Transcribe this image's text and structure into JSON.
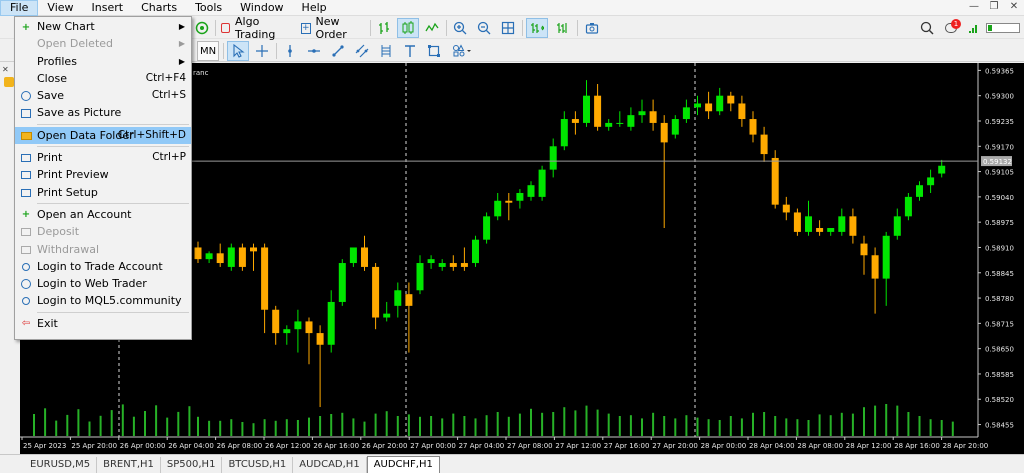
{
  "menu": {
    "items": [
      "File",
      "View",
      "Insert",
      "Charts",
      "Tools",
      "Window",
      "Help"
    ],
    "active_index": 0
  },
  "toolbar1": {
    "algo_trading": "Algo Trading",
    "new_order": "New Order",
    "notification_count": "1"
  },
  "toolbar2": {
    "timeframe": "MN"
  },
  "chart": {
    "symbol_fragment": "ranc",
    "current_price": "0.59132",
    "bull_color": "#00e600",
    "bear_color": "#ffaa00",
    "background": "#000000"
  },
  "chart_data": {
    "type": "candlestick",
    "symbol_tab": "AUDCHF,H1",
    "y_ticks": [
      "0.59365",
      "0.59300",
      "0.59235",
      "0.59170",
      "0.59105",
      "0.59040",
      "0.58975",
      "0.58910",
      "0.58845",
      "0.58780",
      "0.58715",
      "0.58650",
      "0.58585",
      "0.58520",
      "0.58455"
    ],
    "ylim": [
      0.58423,
      0.59384
    ],
    "x_ticks": [
      "25 Apr 2023",
      "25 Apr 20:00",
      "26 Apr 00:00",
      "26 Apr 04:00",
      "26 Apr 08:00",
      "26 Apr 12:00",
      "26 Apr 16:00",
      "26 Apr 20:00",
      "27 Apr 00:00",
      "27 Apr 04:00",
      "27 Apr 08:00",
      "27 Apr 12:00",
      "27 Apr 16:00",
      "27 Apr 20:00",
      "28 Apr 00:00",
      "28 Apr 04:00",
      "28 Apr 08:00",
      "28 Apr 12:00",
      "28 Apr 16:00",
      "28 Apr 20:00"
    ],
    "candles": [
      {
        "o": 0.5891,
        "h": 0.58925,
        "c": 0.5888,
        "l": 0.5887
      },
      {
        "o": 0.5888,
        "h": 0.589,
        "c": 0.58895,
        "l": 0.5887
      },
      {
        "o": 0.58895,
        "h": 0.5892,
        "c": 0.5887,
        "l": 0.5886
      },
      {
        "o": 0.5886,
        "h": 0.5892,
        "c": 0.5891,
        "l": 0.5885
      },
      {
        "o": 0.5891,
        "h": 0.5892,
        "c": 0.5886,
        "l": 0.5885
      },
      {
        "o": 0.5891,
        "h": 0.5892,
        "c": 0.589,
        "l": 0.5885
      },
      {
        "o": 0.5891,
        "h": 0.5892,
        "c": 0.5875,
        "l": 0.5869
      },
      {
        "o": 0.5875,
        "h": 0.5876,
        "c": 0.5869,
        "l": 0.5866
      },
      {
        "o": 0.5869,
        "h": 0.5871,
        "c": 0.587,
        "l": 0.5866
      },
      {
        "o": 0.587,
        "h": 0.5875,
        "c": 0.5872,
        "l": 0.5864
      },
      {
        "o": 0.5872,
        "h": 0.5873,
        "c": 0.5869,
        "l": 0.5861
      },
      {
        "o": 0.5869,
        "h": 0.5871,
        "c": 0.5866,
        "l": 0.585
      },
      {
        "o": 0.5866,
        "h": 0.588,
        "c": 0.5877,
        "l": 0.5864
      },
      {
        "o": 0.5877,
        "h": 0.5888,
        "c": 0.5887,
        "l": 0.5876
      },
      {
        "o": 0.5887,
        "h": 0.5889,
        "c": 0.5891,
        "l": 0.5886
      },
      {
        "o": 0.5891,
        "h": 0.5894,
        "c": 0.5886,
        "l": 0.5885
      },
      {
        "o": 0.5886,
        "h": 0.5887,
        "c": 0.5873,
        "l": 0.587
      },
      {
        "o": 0.5873,
        "h": 0.5877,
        "c": 0.5874,
        "l": 0.5872
      },
      {
        "o": 0.5876,
        "h": 0.5882,
        "c": 0.588,
        "l": 0.5873
      },
      {
        "o": 0.5879,
        "h": 0.5882,
        "c": 0.5876,
        "l": 0.5864
      },
      {
        "o": 0.588,
        "h": 0.5889,
        "c": 0.5887,
        "l": 0.5879
      },
      {
        "o": 0.5887,
        "h": 0.5889,
        "c": 0.5888,
        "l": 0.58855
      },
      {
        "o": 0.5886,
        "h": 0.5888,
        "c": 0.5887,
        "l": 0.5885
      },
      {
        "o": 0.5887,
        "h": 0.5889,
        "c": 0.5886,
        "l": 0.5885
      },
      {
        "o": 0.5887,
        "h": 0.5891,
        "c": 0.5886,
        "l": 0.5885
      },
      {
        "o": 0.5887,
        "h": 0.5894,
        "c": 0.5893,
        "l": 0.5886
      },
      {
        "o": 0.5893,
        "h": 0.59,
        "c": 0.5899,
        "l": 0.5892
      },
      {
        "o": 0.5899,
        "h": 0.5905,
        "c": 0.5903,
        "l": 0.5898
      },
      {
        "o": 0.5903,
        "h": 0.5905,
        "c": 0.59025,
        "l": 0.5898
      },
      {
        "o": 0.5903,
        "h": 0.5906,
        "c": 0.5905,
        "l": 0.5901
      },
      {
        "o": 0.5904,
        "h": 0.5908,
        "c": 0.5907,
        "l": 0.5903
      },
      {
        "o": 0.5904,
        "h": 0.5912,
        "c": 0.5911,
        "l": 0.5903
      },
      {
        "o": 0.5911,
        "h": 0.5919,
        "c": 0.5917,
        "l": 0.5909
      },
      {
        "o": 0.5917,
        "h": 0.5926,
        "c": 0.5924,
        "l": 0.5916
      },
      {
        "o": 0.5924,
        "h": 0.5926,
        "c": 0.5923,
        "l": 0.592
      },
      {
        "o": 0.5923,
        "h": 0.5934,
        "c": 0.593,
        "l": 0.5922
      },
      {
        "o": 0.593,
        "h": 0.5933,
        "c": 0.5922,
        "l": 0.5921
      },
      {
        "o": 0.5922,
        "h": 0.5924,
        "c": 0.5923,
        "l": 0.5921
      },
      {
        "o": 0.5923,
        "h": 0.5926,
        "c": 0.5923,
        "l": 0.5922
      },
      {
        "o": 0.5922,
        "h": 0.5927,
        "c": 0.5925,
        "l": 0.5921
      },
      {
        "o": 0.5925,
        "h": 0.5929,
        "c": 0.5926,
        "l": 0.5923
      },
      {
        "o": 0.5926,
        "h": 0.5929,
        "c": 0.5923,
        "l": 0.5921
      },
      {
        "o": 0.5923,
        "h": 0.5925,
        "c": 0.5918,
        "l": 0.5896
      },
      {
        "o": 0.592,
        "h": 0.5925,
        "c": 0.5924,
        "l": 0.5919
      },
      {
        "o": 0.5924,
        "h": 0.5929,
        "c": 0.5927,
        "l": 0.5923
      },
      {
        "o": 0.5927,
        "h": 0.593,
        "c": 0.5928,
        "l": 0.5925
      },
      {
        "o": 0.5928,
        "h": 0.5931,
        "c": 0.5926,
        "l": 0.5924
      },
      {
        "o": 0.5926,
        "h": 0.5932,
        "c": 0.593,
        "l": 0.5925
      },
      {
        "o": 0.593,
        "h": 0.5931,
        "c": 0.5928,
        "l": 0.5926
      },
      {
        "o": 0.5928,
        "h": 0.593,
        "c": 0.5924,
        "l": 0.5922
      },
      {
        "o": 0.5924,
        "h": 0.5926,
        "c": 0.592,
        "l": 0.5918
      },
      {
        "o": 0.592,
        "h": 0.5922,
        "c": 0.5915,
        "l": 0.5913
      },
      {
        "o": 0.5914,
        "h": 0.5916,
        "c": 0.5902,
        "l": 0.5901
      },
      {
        "o": 0.5902,
        "h": 0.5904,
        "c": 0.59,
        "l": 0.5898
      },
      {
        "o": 0.59,
        "h": 0.5901,
        "c": 0.5895,
        "l": 0.5894
      },
      {
        "o": 0.5895,
        "h": 0.5903,
        "c": 0.5899,
        "l": 0.5894
      },
      {
        "o": 0.5896,
        "h": 0.5898,
        "c": 0.5895,
        "l": 0.5894
      },
      {
        "o": 0.5895,
        "h": 0.5896,
        "c": 0.5896,
        "l": 0.5894
      },
      {
        "o": 0.5895,
        "h": 0.5901,
        "c": 0.5899,
        "l": 0.5894
      },
      {
        "o": 0.5899,
        "h": 0.5901,
        "c": 0.5894,
        "l": 0.5892
      },
      {
        "o": 0.5892,
        "h": 0.5894,
        "c": 0.5889,
        "l": 0.5884
      },
      {
        "o": 0.5889,
        "h": 0.5891,
        "c": 0.5883,
        "l": 0.5874
      },
      {
        "o": 0.5883,
        "h": 0.5895,
        "c": 0.5894,
        "l": 0.5876
      },
      {
        "o": 0.5894,
        "h": 0.5901,
        "c": 0.5899,
        "l": 0.5893
      },
      {
        "o": 0.5899,
        "h": 0.5905,
        "c": 0.5904,
        "l": 0.5898
      },
      {
        "o": 0.5904,
        "h": 0.5908,
        "c": 0.5907,
        "l": 0.5903
      },
      {
        "o": 0.5907,
        "h": 0.5911,
        "c": 0.5909,
        "l": 0.5905
      },
      {
        "o": 0.591,
        "h": 0.59135,
        "c": 0.5912,
        "l": 0.5909
      }
    ],
    "volumes": [
      0.48,
      0.38,
      0.38,
      0.42,
      0.35,
      0.32,
      0.42,
      0.38,
      0.42,
      0.4,
      0.46,
      0.5,
      0.55,
      0.58,
      0.44,
      0.36,
      0.56,
      0.62,
      0.5,
      0.54,
      0.48,
      0.5,
      0.44,
      0.56,
      0.5,
      0.44,
      0.52,
      0.6,
      0.48,
      0.56,
      0.68,
      0.58,
      0.6,
      0.72,
      0.64,
      0.76,
      0.66,
      0.56,
      0.5,
      0.52,
      0.44,
      0.58,
      0.5,
      0.44,
      0.52,
      0.46,
      0.42,
      0.4,
      0.5,
      0.44,
      0.58,
      0.6,
      0.5,
      0.44,
      0.42,
      0.4,
      0.54,
      0.52,
      0.58,
      0.56,
      0.72,
      0.76,
      0.8,
      0.76,
      0.6,
      0.5,
      0.42,
      0.4,
      0.36
    ]
  },
  "file_menu": {
    "items": [
      {
        "label": "New Chart",
        "shortcut": "",
        "icon": "new-chart-icon",
        "disabled": false,
        "submenu": true
      },
      {
        "label": "Open Deleted",
        "shortcut": "",
        "icon": "",
        "disabled": true,
        "submenu": true
      },
      {
        "label": "Profiles",
        "shortcut": "",
        "icon": "",
        "disabled": false,
        "submenu": true
      },
      {
        "label": "Close",
        "shortcut": "Ctrl+F4",
        "icon": "",
        "disabled": false,
        "submenu": false
      },
      {
        "label": "Save",
        "shortcut": "Ctrl+S",
        "icon": "save-icon",
        "disabled": false,
        "submenu": false
      },
      {
        "label": "Save as Picture",
        "shortcut": "",
        "icon": "picture-icon",
        "disabled": false,
        "submenu": false
      },
      {
        "sep": true
      },
      {
        "label": "Open Data Folder",
        "shortcut": "Ctrl+Shift+D",
        "icon": "folder-icon",
        "disabled": false,
        "submenu": false,
        "highlight": true
      },
      {
        "sep": true
      },
      {
        "label": "Print",
        "shortcut": "Ctrl+P",
        "icon": "print-icon",
        "disabled": false,
        "submenu": false
      },
      {
        "label": "Print Preview",
        "shortcut": "",
        "icon": "print-preview-icon",
        "disabled": false,
        "submenu": false
      },
      {
        "label": "Print Setup",
        "shortcut": "",
        "icon": "print-setup-icon",
        "disabled": false,
        "submenu": false
      },
      {
        "sep": true
      },
      {
        "label": "Open an Account",
        "shortcut": "",
        "icon": "plus-icon",
        "disabled": false,
        "submenu": false
      },
      {
        "label": "Deposit",
        "shortcut": "",
        "icon": "deposit-icon",
        "disabled": true,
        "submenu": false
      },
      {
        "label": "Withdrawal",
        "shortcut": "",
        "icon": "withdrawal-icon",
        "disabled": true,
        "submenu": false
      },
      {
        "label": "Login to Trade Account",
        "shortcut": "",
        "icon": "user-icon",
        "disabled": false,
        "submenu": false
      },
      {
        "label": "Login to Web Trader",
        "shortcut": "",
        "icon": "globe-icon",
        "disabled": false,
        "submenu": false
      },
      {
        "label": "Login to MQL5.community",
        "shortcut": "",
        "icon": "user-icon",
        "disabled": false,
        "submenu": false
      },
      {
        "sep": true
      },
      {
        "label": "Exit",
        "shortcut": "",
        "icon": "exit-icon",
        "disabled": false,
        "submenu": false
      }
    ]
  },
  "tabs": {
    "items": [
      "EURUSD,M5",
      "BRENT,H1",
      "SP500,H1",
      "BTCUSD,H1",
      "AUDCAD,H1",
      "AUDCHF,H1"
    ],
    "active_index": 5,
    "left_stub": "C"
  }
}
